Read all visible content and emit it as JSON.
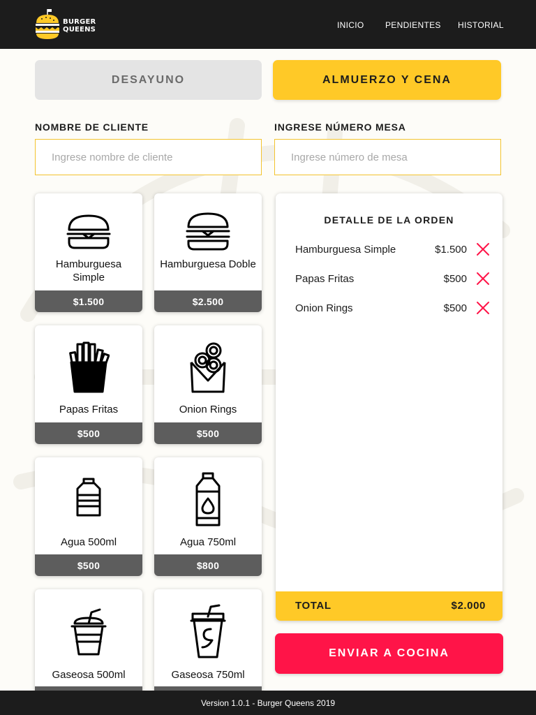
{
  "header": {
    "logo_line1": "BURGER",
    "logo_line2": "QUEENS",
    "nav": [
      {
        "label": "INICIO"
      },
      {
        "label": "PENDIENTES"
      },
      {
        "label": "HISTORIAL"
      }
    ]
  },
  "menu_tabs": {
    "breakfast": "DESAYUNO",
    "lunch_dinner": "ALMUERZO Y CENA",
    "active": "lunch_dinner",
    "active_color": "#ffc927"
  },
  "form": {
    "client_label": "NOMBRE DE CLIENTE",
    "client_placeholder": "Ingrese nombre de cliente",
    "client_value": "",
    "table_label": "INGRESE NÚMERO MESA",
    "table_placeholder": "Ingrese número de mesa",
    "table_value": ""
  },
  "products": [
    {
      "name": "Hamburguesa Simple",
      "price": "$1.500",
      "icon": "burger-icon"
    },
    {
      "name": "Hamburguesa Doble",
      "price": "$2.500",
      "icon": "double-burger-icon"
    },
    {
      "name": "Papas Fritas",
      "price": "$500",
      "icon": "fries-icon"
    },
    {
      "name": "Onion Rings",
      "price": "$500",
      "icon": "onion-rings-icon"
    },
    {
      "name": "Agua 500ml",
      "price": "$500",
      "icon": "water-bottle-small-icon"
    },
    {
      "name": "Agua 750ml",
      "price": "$800",
      "icon": "water-bottle-large-icon"
    },
    {
      "name": "Gaseosa 500ml",
      "price": "",
      "icon": "soda-cup-icon"
    },
    {
      "name": "Gaseosa 750ml",
      "price": "",
      "icon": "soda-cup-large-icon"
    }
  ],
  "order": {
    "title": "DETALLE DE LA ORDEN",
    "items": [
      {
        "name": "Hamburguesa Simple",
        "price": "$1.500"
      },
      {
        "name": "Papas Fritas",
        "price": "$500"
      },
      {
        "name": "Onion Rings",
        "price": "$500"
      }
    ],
    "total_label": "TOTAL",
    "total_value": "$2.000",
    "remove_icon": "close-x-icon",
    "remove_color": "#ff1448"
  },
  "send_button": "ENVIAR A COCINA",
  "footer": "Version 1.0.1 - Burger Queens 2019"
}
